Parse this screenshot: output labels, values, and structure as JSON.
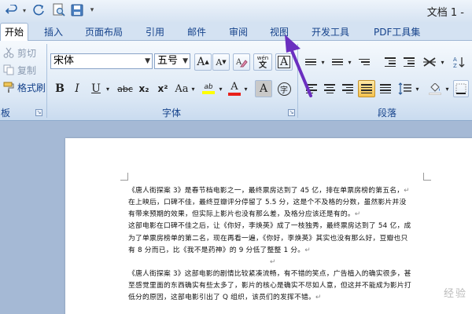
{
  "window": {
    "title": "文档 1 -"
  },
  "tabs": [
    {
      "label": "开始",
      "active": true
    },
    {
      "label": "插入"
    },
    {
      "label": "页面布局"
    },
    {
      "label": "引用"
    },
    {
      "label": "邮件"
    },
    {
      "label": "审阅"
    },
    {
      "label": "视图"
    },
    {
      "label": "开发工具"
    },
    {
      "label": "PDF工具集"
    }
  ],
  "clipboard": {
    "cut": "剪切",
    "copy": "复制",
    "format_painter": "格式刷",
    "group_label": "板"
  },
  "font": {
    "font_name": "宋体",
    "font_size": "五号",
    "grow": "A",
    "shrink": "A",
    "clear_format": "A",
    "phonetic": "wén",
    "border_char": "A",
    "bold": "B",
    "italic": "I",
    "underline": "U",
    "strike": "abc",
    "subscript": "x₂",
    "superscript": "x²",
    "change_case": "Aa",
    "highlight": "ab",
    "font_color": "A",
    "shading": "A",
    "enclose": "字",
    "group_label": "字体"
  },
  "paragraph": {
    "group_label": "段落"
  },
  "document": {
    "paragraphs": [
      "《唐人街探案 3》是春节档电影之一，最终票房达到了 45 亿，排在单票房榜的第五名，",
      "在上映后，口碑不佳，最终豆瓣评分停留了 5.5 分，这是个不及格的分数，虽然影片并没",
      "有带来预期的效果，但实际上影片也没有那么差，及格分应该还是有的。",
      "这部电影在口碑不佳之后，让《你好，李焕英》成了一枝独秀，最终票房达到了 54 亿，成",
      "为了单票房榜单的第二名，现在再看一遍，《你好，李焕英》其实也没有那么好，豆瓣也只",
      "有 8 分而已，比《我不是药神》的 9 分低了整整 1 分。",
      "",
      "《唐人街探案 3》这部电影的剧情比较紧凑流畅，有不错的笑点，广告植入的确实很多，甚",
      "至感觉里面的东西确实有些太多了，影片的核心是确实不尽如人意，但这并不能成为影片打",
      "低分的原因，这部电影引出了 Q 组织，该员们的发挥不错。"
    ],
    "paragraph_mark": "↵"
  },
  "watermark": "经验"
}
